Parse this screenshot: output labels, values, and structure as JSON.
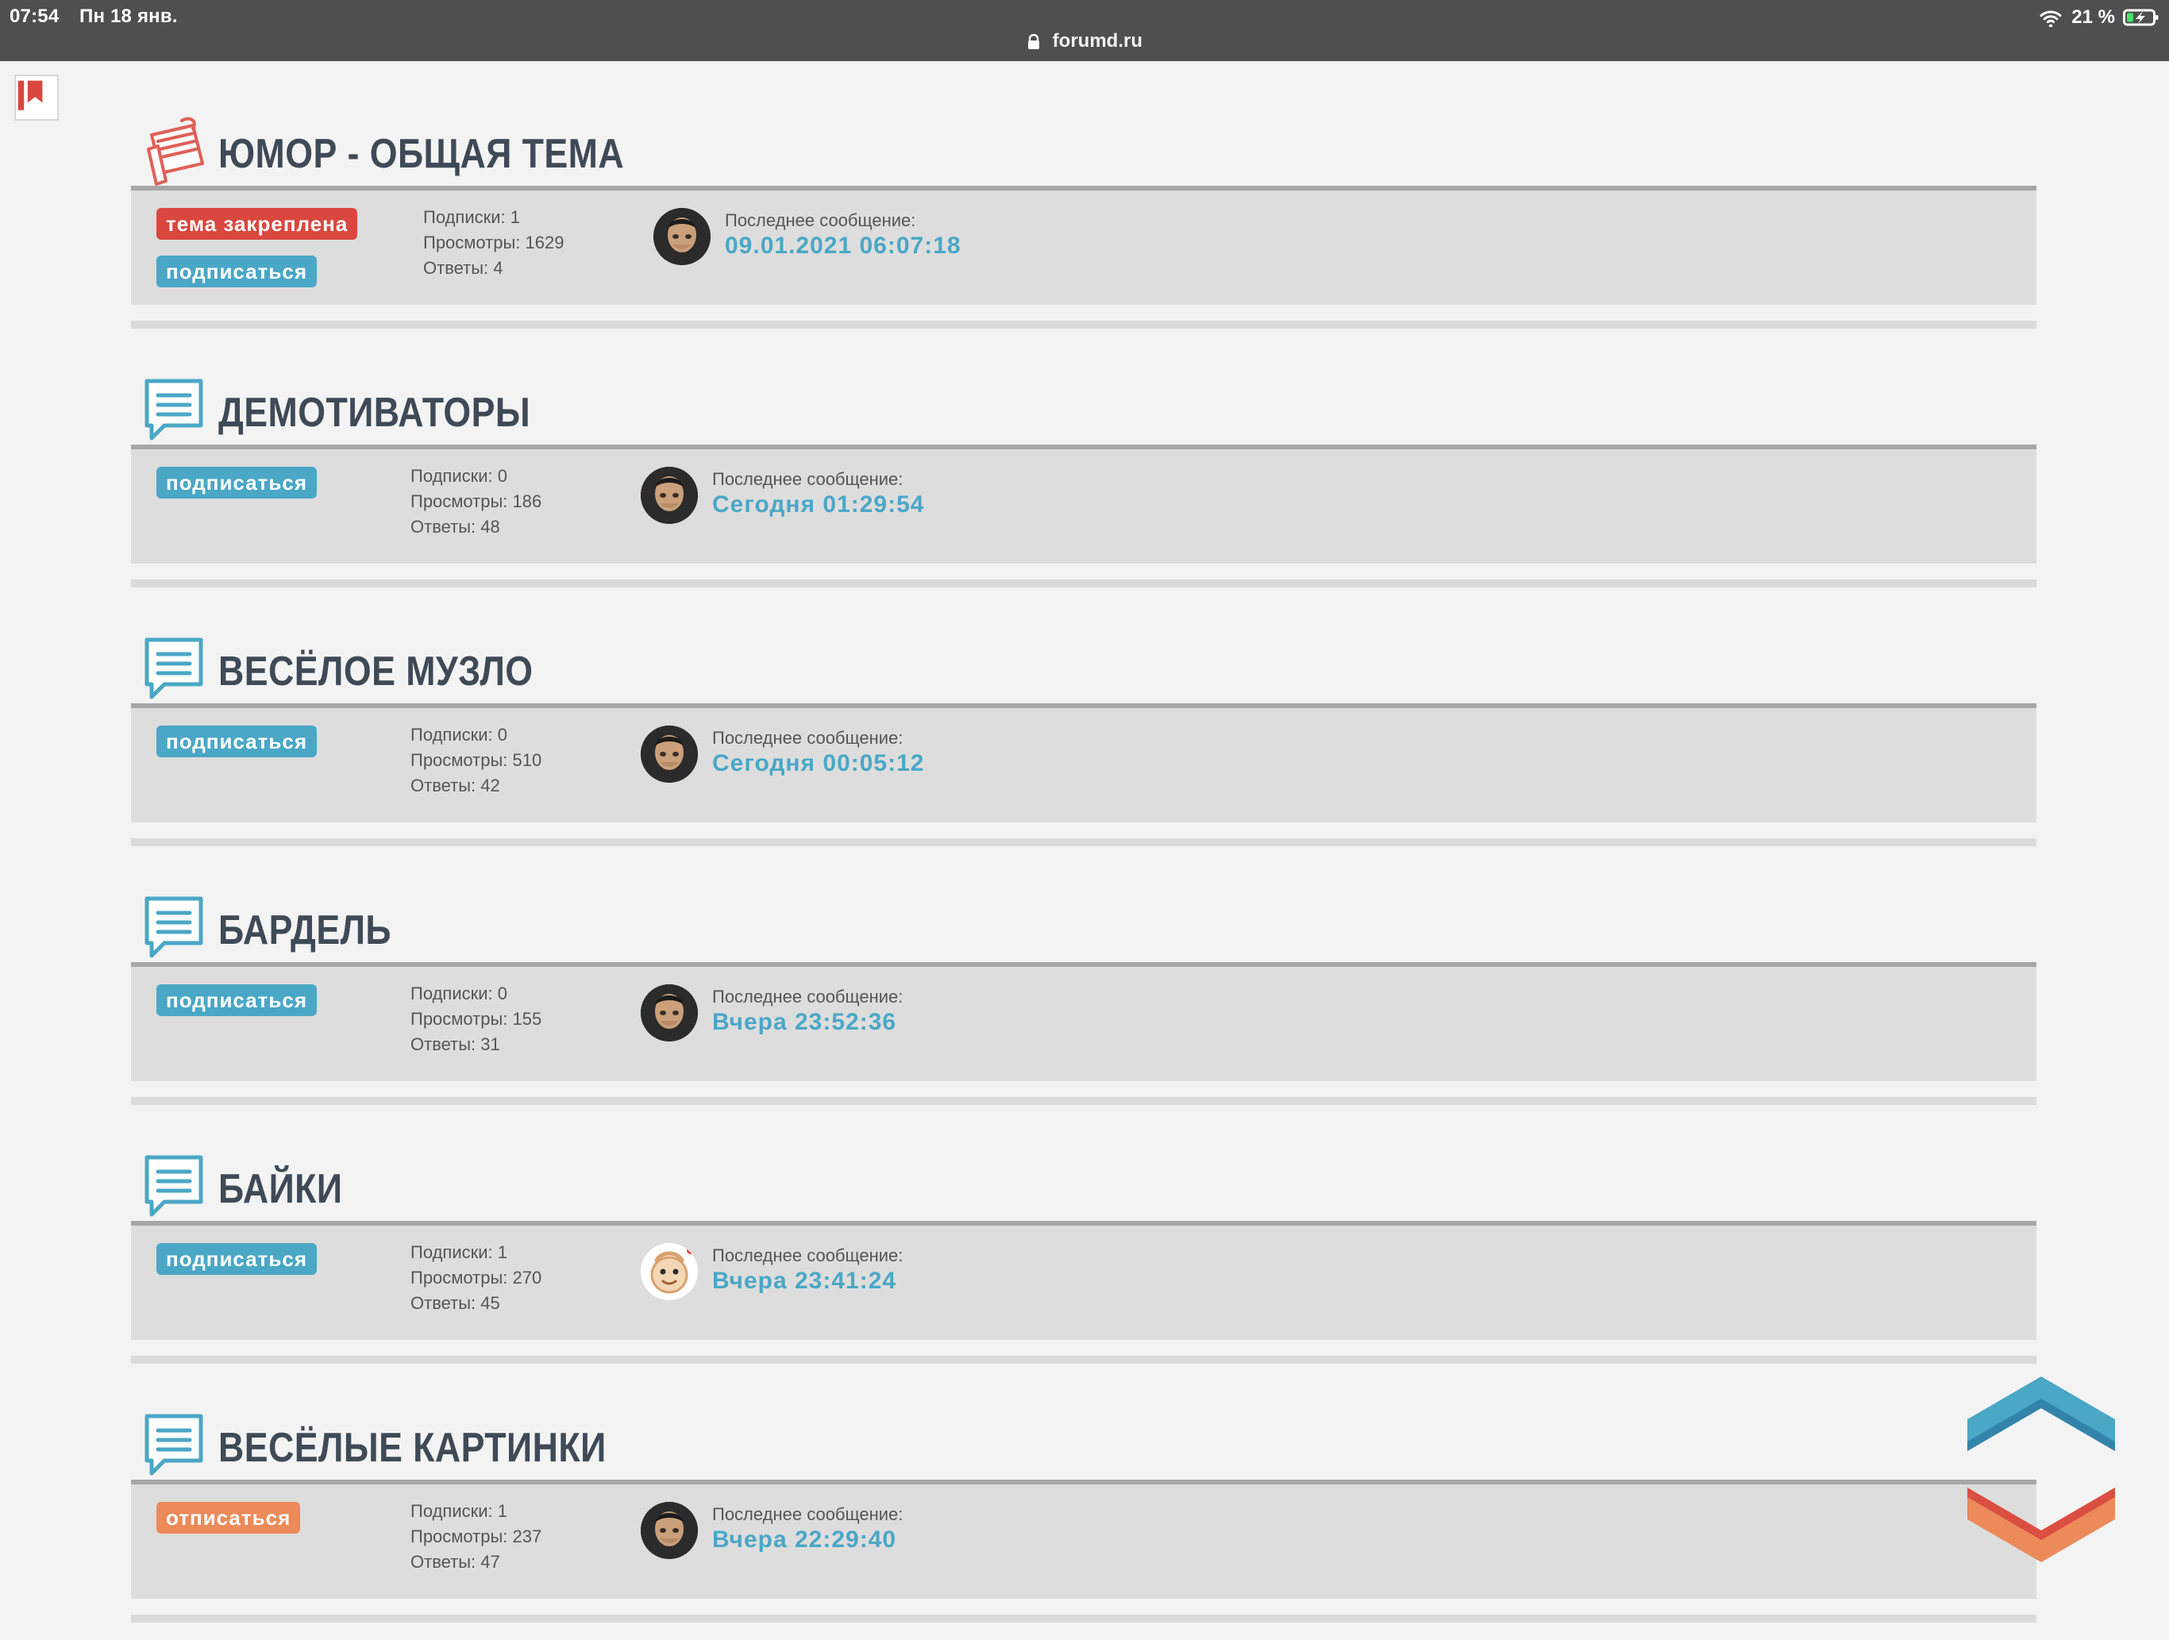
{
  "statusbar": {
    "time": "07:54",
    "date": "Пн 18 янв.",
    "battery_percent": "21 %"
  },
  "addressbar": {
    "domain": "forumd.ru"
  },
  "labels": {
    "subs_prefix": "Подписки: ",
    "views_prefix": "Просмотры: ",
    "replies_prefix": "Ответы: ",
    "last_message": "Последнее сообщение:"
  },
  "topics": [
    {
      "title": "ЮМОР - ОБЩАЯ ТЕМА",
      "icon": "notes-icon",
      "badges": [
        {
          "type": "pinned",
          "label": "тема закреплена",
          "interactable": false
        },
        {
          "type": "subscribe",
          "label": "подписаться",
          "interactable": true
        }
      ],
      "subscriptions": "1",
      "views": "1629",
      "replies": "4",
      "last_time": "09.01.2021 06:07:18",
      "avatar": "man"
    },
    {
      "title": "ДЕМОТИВАТОРЫ",
      "icon": "chat-icon",
      "badges": [
        {
          "type": "subscribe",
          "label": "подписаться",
          "interactable": true
        }
      ],
      "subscriptions": "0",
      "views": "186",
      "replies": "48",
      "last_time": "Сегодня 01:29:54",
      "avatar": "man"
    },
    {
      "title": "ВЕСЁЛОЕ МУЗЛО",
      "icon": "chat-icon",
      "badges": [
        {
          "type": "subscribe",
          "label": "подписаться",
          "interactable": true
        }
      ],
      "subscriptions": "0",
      "views": "510",
      "replies": "42",
      "last_time": "Сегодня 00:05:12",
      "avatar": "man"
    },
    {
      "title": "БАРДЕЛЬ",
      "icon": "chat-icon",
      "badges": [
        {
          "type": "subscribe",
          "label": "подписаться",
          "interactable": true
        }
      ],
      "subscriptions": "0",
      "views": "155",
      "replies": "31",
      "last_time": "Вчера 23:52:36",
      "avatar": "man"
    },
    {
      "title": "БАЙКИ",
      "icon": "chat-icon",
      "badges": [
        {
          "type": "subscribe",
          "label": "подписаться",
          "interactable": true
        }
      ],
      "subscriptions": "1",
      "views": "270",
      "replies": "45",
      "last_time": "Вчера 23:41:24",
      "avatar": "cartoon"
    },
    {
      "title": "ВЕСЁЛЫЕ КАРТИНКИ",
      "icon": "chat-icon",
      "badges": [
        {
          "type": "unsubscribe",
          "label": "отписаться",
          "interactable": true
        }
      ],
      "subscriptions": "1",
      "views": "237",
      "replies": "47",
      "last_time": "Вчера 22:29:40",
      "avatar": "man"
    }
  ],
  "nav": {
    "scroll_up_icon": "chevron-up-icon",
    "scroll_down_icon": "chevron-down-icon"
  },
  "colors": {
    "blue": "#4aa7c6",
    "red": "#d9473f",
    "orange": "#ec8a5a",
    "panel": "#dddddd",
    "page": "#f3f3f3"
  }
}
